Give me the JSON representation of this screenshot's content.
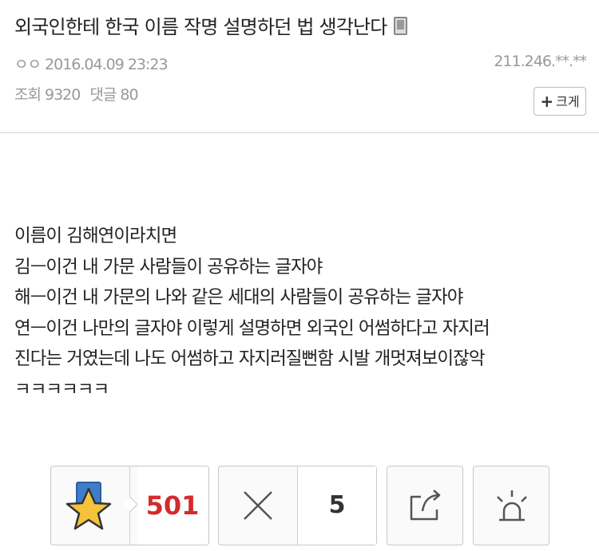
{
  "post": {
    "title": "외국인한테 한국 이름 작명 설명하던 법 생각난다",
    "author": "ㅇㅇ",
    "date": "2016.04.09 23:23",
    "ip": "211.246.**.**",
    "views_label": "조회 9320",
    "comments_label": "댓글 80",
    "size_button": "크게",
    "size_button_symbol": "+",
    "source_icon": "mobile-icon"
  },
  "content": {
    "lines": [
      "이름이 김해연이라치면",
      "김ㅡ이건 내 가문 사람들이 공유하는 글자야",
      "해ㅡ이건 내 가문의 나와 같은 세대의 사람들이 공유하는 글자야",
      "연ㅡ이건 나만의 글자야 이렇게 설명하면 외국인 어썸하다고 자지러",
      "진다는 거였는데 나도 어썸하고 자지러질뻔함 시발 개멋져보이잖악",
      "ㅋㅋㅋㅋㅋㅋ"
    ]
  },
  "actions": {
    "recommend_count": "501",
    "not_recommend_count": "5",
    "icons": [
      "star-icon",
      "close-x-icon",
      "share-icon",
      "report-siren-icon"
    ],
    "colors": {
      "recommend": "#d32b2b",
      "star_fill": "#f5c33b",
      "star_bg": "#3f7cc9"
    }
  }
}
